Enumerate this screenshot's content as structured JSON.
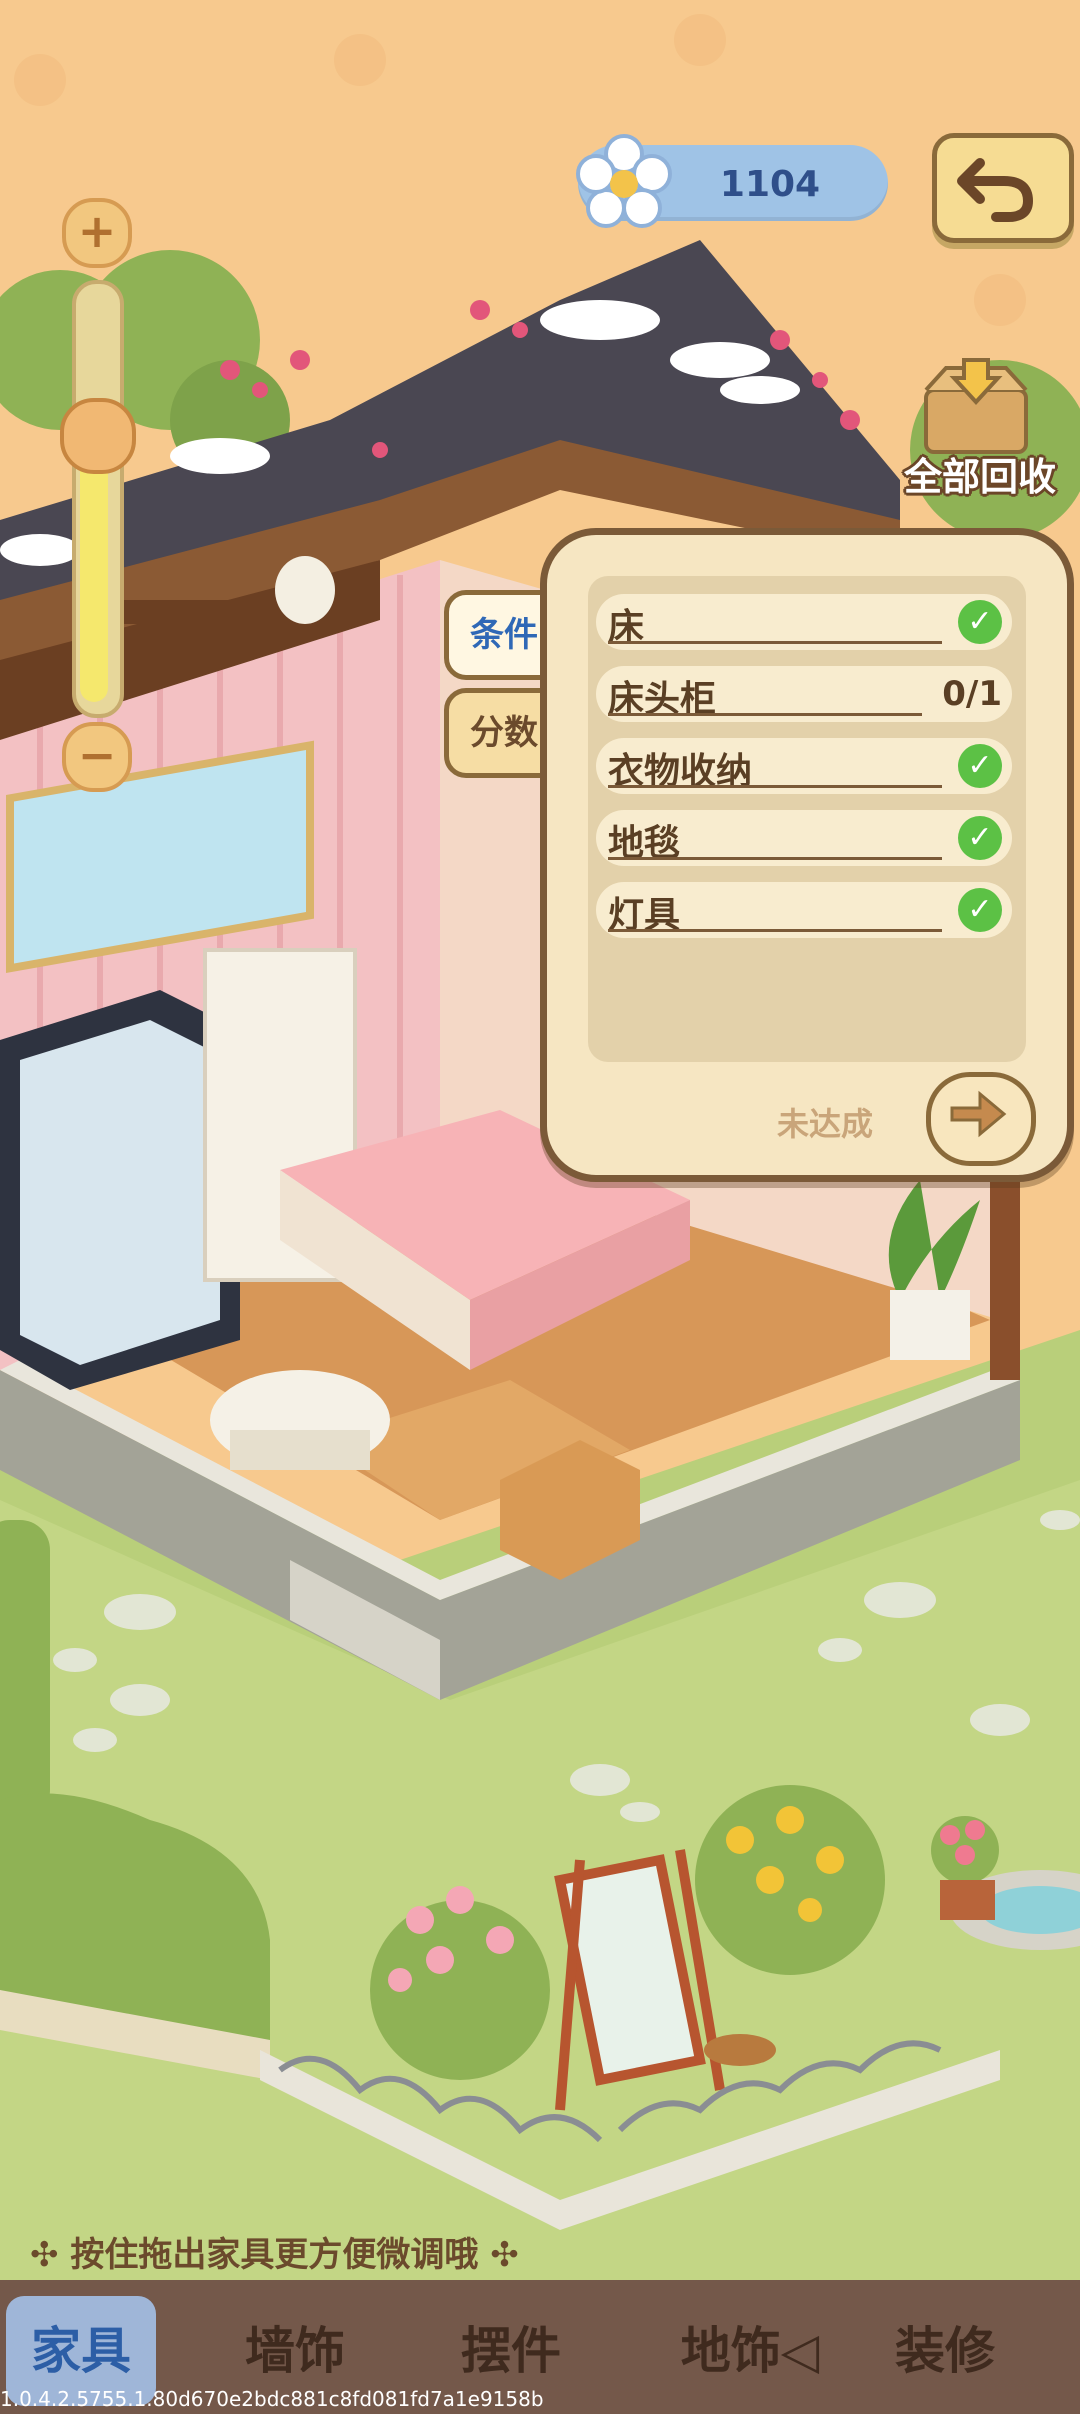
{
  "top_bar": {
    "currency_value": "1104",
    "currency_icon": "flower-icon",
    "back_icon": "undo-arrow-icon"
  },
  "zoom": {
    "plus_label": "+",
    "minus_label": "−",
    "level": 0.6
  },
  "recycle": {
    "label": "全部回收",
    "icon": "box-icon"
  },
  "side_tabs": [
    {
      "label": "条件"
    },
    {
      "label": "分数"
    }
  ],
  "conditions": {
    "items": [
      {
        "label": "床",
        "status": "done"
      },
      {
        "label": "床头柜",
        "status": "0/1"
      },
      {
        "label": "衣物收纳",
        "status": "done"
      },
      {
        "label": "地毯",
        "status": "done"
      },
      {
        "label": "灯具",
        "status": "done"
      }
    ],
    "footer_status": "未达成",
    "next_icon": "arrow-right-icon"
  },
  "hint": {
    "text": "按住拖出家具更方便微调哦",
    "icon": "sparkle-icon"
  },
  "bottom_nav": {
    "items": [
      {
        "label": "家具"
      },
      {
        "label": "墙饰"
      },
      {
        "label": "摆件"
      },
      {
        "label": "地饰◁"
      },
      {
        "label": "装修"
      }
    ]
  },
  "version": "1.0.4.2.5755.1.80d670e2bdc881c8fd081fd7a1e9158b",
  "colors": {
    "background": "#f7c98e",
    "accent_blue": "#2f68b6",
    "check_green": "#5cc145",
    "panel_border": "#7b5a38"
  }
}
